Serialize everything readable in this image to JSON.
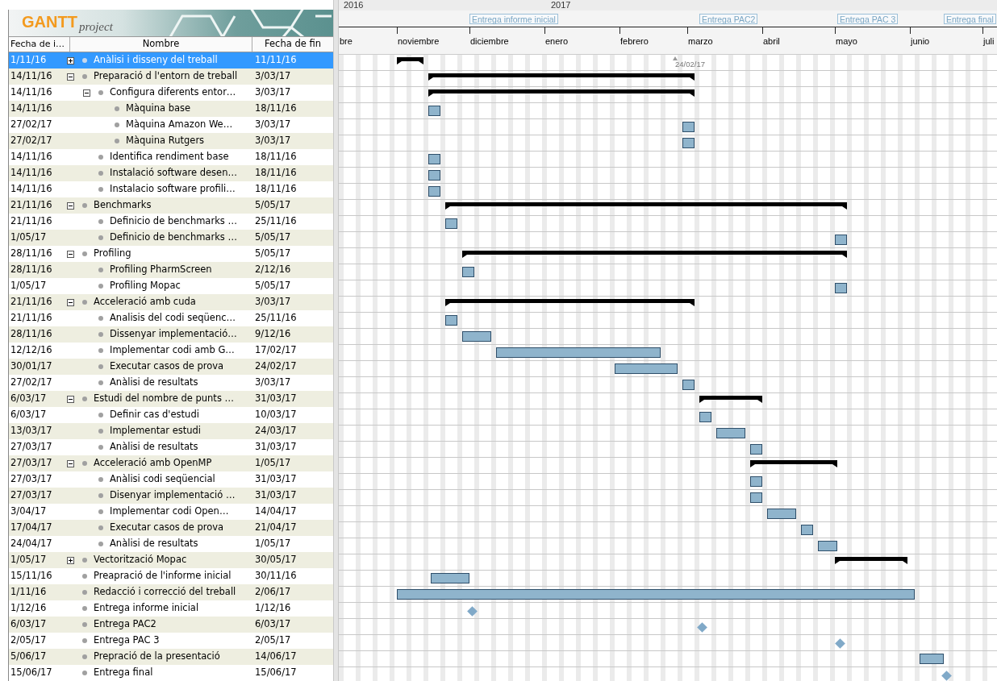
{
  "logo": {
    "title": "GANTT",
    "subtitle": "project"
  },
  "table": {
    "columns": [
      "Fecha de i…",
      "Nombre",
      "Fecha de fin"
    ],
    "tasks": [
      {
        "start": "1/11/16",
        "name": "Anàlisi i disseny del treball",
        "end": "11/11/16",
        "kind": "summary",
        "expanded": false,
        "selected": true
      },
      {
        "start": "14/11/16",
        "name": "Preparació d l'entorn de treball",
        "end": "3/03/17",
        "kind": "summary",
        "expanded": true,
        "selected": false,
        "children": [
          {
            "start": "14/11/16",
            "name": "Configura diferents entor…",
            "end": "3/03/17",
            "kind": "summary",
            "expanded": true,
            "selected": false,
            "children": [
              {
                "start": "14/11/16",
                "name": "Màquina base",
                "end": "18/11/16",
                "kind": "task",
                "selected": false
              },
              {
                "start": "27/02/17",
                "name": "Màquina Amazon We…",
                "end": "3/03/17",
                "kind": "task",
                "selected": false
              },
              {
                "start": "27/02/17",
                "name": "Màquina Rutgers",
                "end": "3/03/17",
                "kind": "task",
                "selected": false
              }
            ]
          },
          {
            "start": "14/11/16",
            "name": "Identifica rendiment base",
            "end": "18/11/16",
            "kind": "task",
            "selected": false
          },
          {
            "start": "14/11/16",
            "name": "Instalació software desen…",
            "end": "18/11/16",
            "kind": "task",
            "selected": false
          },
          {
            "start": "14/11/16",
            "name": "Instalacio software profili…",
            "end": "18/11/16",
            "kind": "task",
            "selected": false
          }
        ]
      },
      {
        "start": "21/11/16",
        "name": "Benchmarks",
        "end": "5/05/17",
        "kind": "summary",
        "expanded": true,
        "selected": false,
        "children": [
          {
            "start": "21/11/16",
            "name": "Definicio de benchmarks …",
            "end": "25/11/16",
            "kind": "task",
            "selected": false
          },
          {
            "start": "1/05/17",
            "name": "Definicio de benchmarks …",
            "end": "5/05/17",
            "kind": "task",
            "selected": false
          }
        ]
      },
      {
        "start": "28/11/16",
        "name": "Profiling",
        "end": "5/05/17",
        "kind": "summary",
        "expanded": true,
        "selected": false,
        "children": [
          {
            "start": "28/11/16",
            "name": "Profiling PharmScreen",
            "end": "2/12/16",
            "kind": "task",
            "selected": false
          },
          {
            "start": "1/05/17",
            "name": "Profiling Mopac",
            "end": "5/05/17",
            "kind": "task",
            "selected": false
          }
        ]
      },
      {
        "start": "21/11/16",
        "name": "Acceleració amb cuda",
        "end": "3/03/17",
        "kind": "summary",
        "expanded": true,
        "selected": false,
        "children": [
          {
            "start": "21/11/16",
            "name": "Analisis del codi seqüenc…",
            "end": "25/11/16",
            "kind": "task",
            "selected": false
          },
          {
            "start": "28/11/16",
            "name": "Dissenyar implementació…",
            "end": "9/12/16",
            "kind": "task",
            "selected": false
          },
          {
            "start": "12/12/16",
            "name": "Implementar codi amb G…",
            "end": "17/02/17",
            "kind": "task",
            "selected": false
          },
          {
            "start": "30/01/17",
            "name": "Executar casos de prova",
            "end": "24/02/17",
            "kind": "task",
            "selected": false
          },
          {
            "start": "27/02/17",
            "name": "Anàlisi de resultats",
            "end": "3/03/17",
            "kind": "task",
            "selected": false
          }
        ]
      },
      {
        "start": "6/03/17",
        "name": "Estudi del nombre de punts …",
        "end": "31/03/17",
        "kind": "summary",
        "expanded": true,
        "selected": false,
        "children": [
          {
            "start": "6/03/17",
            "name": "Definir cas d'estudi",
            "end": "10/03/17",
            "kind": "task",
            "selected": false
          },
          {
            "start": "13/03/17",
            "name": "Implementar estudi",
            "end": "24/03/17",
            "kind": "task",
            "selected": false
          },
          {
            "start": "27/03/17",
            "name": "Anàlisi de resultats",
            "end": "31/03/17",
            "kind": "task",
            "selected": false
          }
        ]
      },
      {
        "start": "27/03/17",
        "name": "Acceleració amb OpenMP",
        "end": "1/05/17",
        "kind": "summary",
        "expanded": true,
        "selected": false,
        "children": [
          {
            "start": "27/03/17",
            "name": "Anàlisi codi seqüencial",
            "end": "31/03/17",
            "kind": "task",
            "selected": false
          },
          {
            "start": "27/03/17",
            "name": "Disenyar implementació …",
            "end": "31/03/17",
            "kind": "task",
            "selected": false
          },
          {
            "start": "3/04/17",
            "name": "Implementar codi Open…",
            "end": "14/04/17",
            "kind": "task",
            "selected": false
          },
          {
            "start": "17/04/17",
            "name": "Executar casos de prova",
            "end": "21/04/17",
            "kind": "task",
            "selected": false
          },
          {
            "start": "24/04/17",
            "name": "Anàlisi de resultats",
            "end": "1/05/17",
            "kind": "task",
            "selected": false
          }
        ]
      },
      {
        "start": "1/05/17",
        "name": "Vectorització Mopac",
        "end": "30/05/17",
        "kind": "summary",
        "expanded": false,
        "selected": false
      },
      {
        "start": "15/11/16",
        "name": "Preapració de l'informe inicial",
        "end": "30/11/16",
        "kind": "task",
        "selected": false
      },
      {
        "start": "1/11/16",
        "name": "Redacció i correcció del treball",
        "end": "2/06/17",
        "kind": "task",
        "selected": false
      },
      {
        "start": "1/12/16",
        "name": "Entrega informe inicial",
        "end": "1/12/16",
        "kind": "milestone",
        "selected": false,
        "flag": "Entrega informe inicial"
      },
      {
        "start": "6/03/17",
        "name": "Entrega PAC2",
        "end": "6/03/17",
        "kind": "milestone",
        "selected": false,
        "flag": "Entrega PAC2"
      },
      {
        "start": "2/05/17",
        "name": "Entrega PAC 3",
        "end": "2/05/17",
        "kind": "milestone",
        "selected": false,
        "flag": "Entrega PAC 3"
      },
      {
        "start": "5/06/17",
        "name": "Prepració de la presentació",
        "end": "14/06/17",
        "kind": "task",
        "selected": false
      },
      {
        "start": "15/06/17",
        "name": "Entrega final",
        "end": "15/06/17",
        "kind": "milestone",
        "selected": false,
        "flag": "Entrega final"
      }
    ]
  },
  "timeline": {
    "years": [
      "2016",
      "2017"
    ],
    "months": [
      "bre",
      "noviembre",
      "diciembre",
      "enero",
      "febrero",
      "marzo",
      "abril",
      "mayo",
      "junio",
      "juli"
    ],
    "today_marker": "24/02/17"
  }
}
